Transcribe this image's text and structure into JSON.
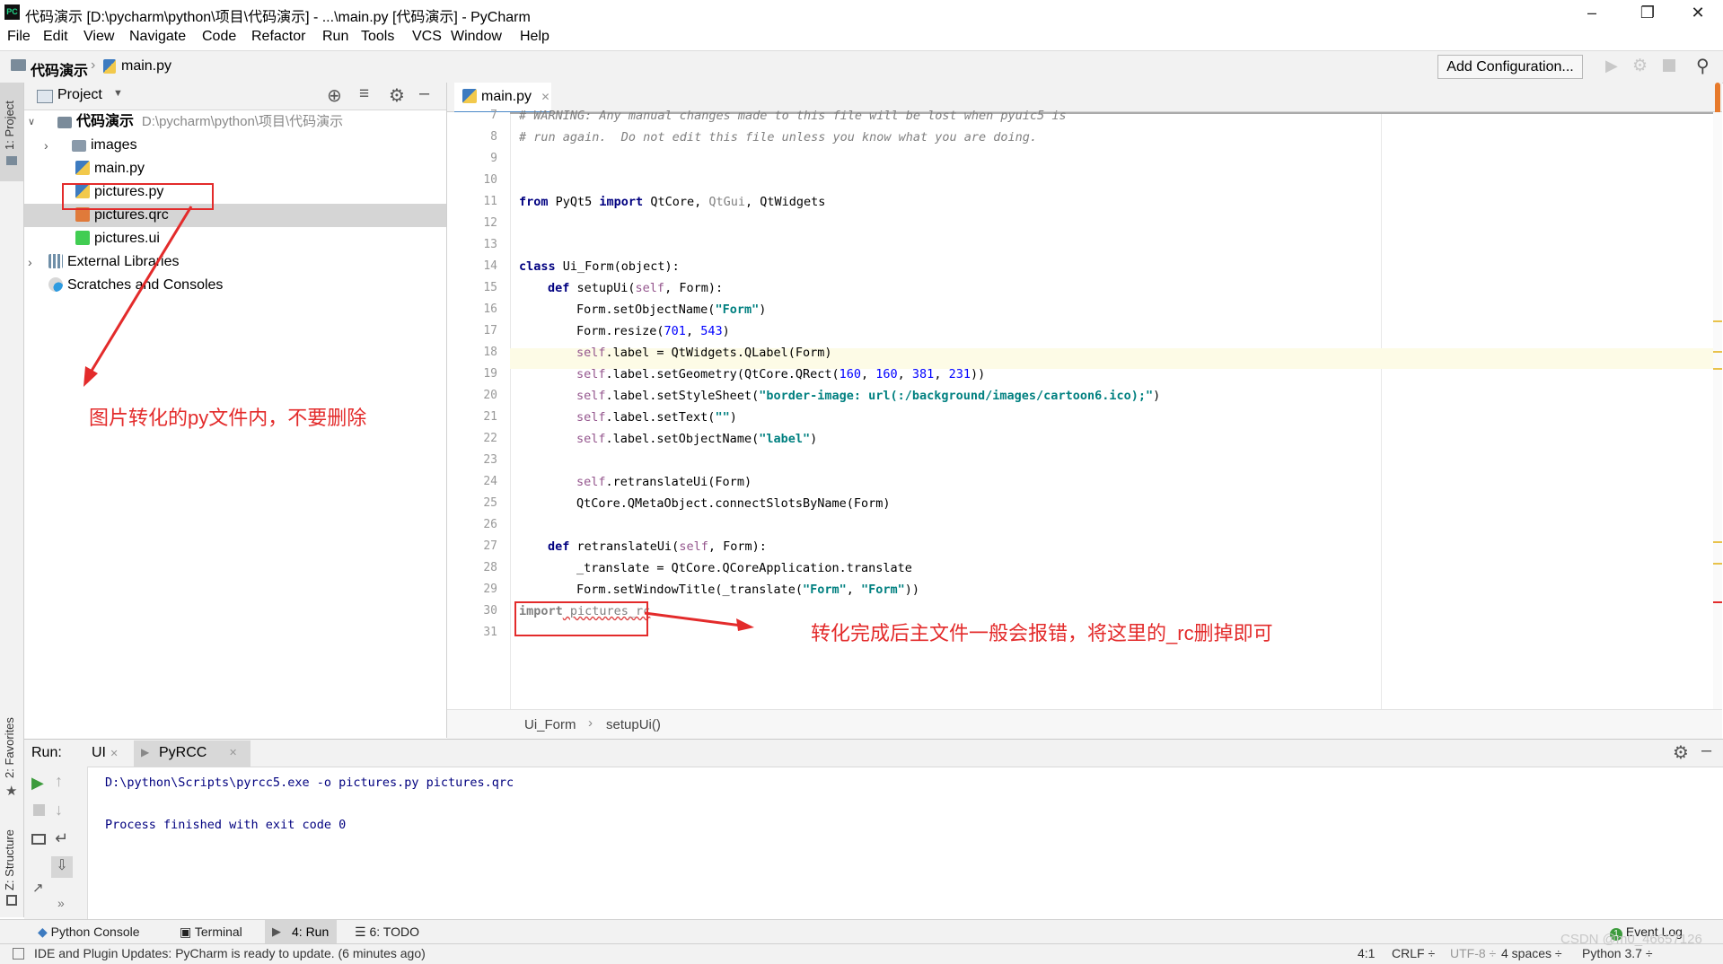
{
  "window": {
    "title": "代码演示 [D:\\pycharm\\python\\项目\\代码演示] - ...\\main.py [代码演示] - PyCharm",
    "app_icon": "PC"
  },
  "menu": [
    "File",
    "Edit",
    "View",
    "Navigate",
    "Code",
    "Refactor",
    "Run",
    "Tools",
    "VCS",
    "Window",
    "Help"
  ],
  "nav": {
    "project": "代码演示",
    "file": "main.py",
    "add_config": "Add Configuration..."
  },
  "left_strip": {
    "project": "1: Project",
    "favorites": "2: Favorites",
    "structure": "Z: Structure"
  },
  "project_panel": {
    "title": "Project",
    "root_name": "代码演示",
    "root_path": "D:\\pycharm\\python\\项目\\代码演示",
    "items": [
      "images",
      "main.py",
      "pictures.py",
      "pictures.qrc",
      "pictures.ui"
    ],
    "external": "External Libraries",
    "scratches": "Scratches and Consoles"
  },
  "editor": {
    "tab": "main.py",
    "line_numbers": [
      "7",
      "8",
      "9",
      "10",
      "11",
      "12",
      "13",
      "14",
      "15",
      "16",
      "17",
      "18",
      "19",
      "20",
      "21",
      "22",
      "23",
      "24",
      "25",
      "26",
      "27",
      "28",
      "29",
      "30",
      "31"
    ],
    "breadcrumb": [
      "Ui_Form",
      "setupUi()"
    ],
    "code": {
      "l7": "# WARNING: Any manual changes made to this file will be lost when pyuic5 is",
      "l8": "# run again.  Do not edit this file unless you know what you are doing.",
      "l11": [
        "from",
        " PyQt5 ",
        "import",
        " QtCore, ",
        "QtGui",
        ", QtWidgets"
      ],
      "l14": [
        "class",
        " Ui_Form(object):"
      ],
      "l15": [
        "def",
        " setupUi(",
        "self",
        ", Form):"
      ],
      "l16": [
        "Form.setObjectName(",
        "\"Form\"",
        ")"
      ],
      "l17": [
        "Form.resize(",
        "701",
        ", ",
        "543",
        ")"
      ],
      "l18": [
        "self",
        ".label = QtWidgets.QLabel(Form)"
      ],
      "l19": [
        "self",
        ".label.setGeometry(QtCore.QRect(",
        "160",
        ", ",
        "160",
        ", ",
        "381",
        ", ",
        "231",
        "))"
      ],
      "l20": [
        "self",
        ".label.setStyleSheet(",
        "\"border-image: url(:/background/images/cartoon6.ico);\"",
        ")"
      ],
      "l21": [
        "self",
        ".label.setText(",
        "\"\"",
        ")"
      ],
      "l22": [
        "self",
        ".label.setObjectName(",
        "\"label\"",
        ")"
      ],
      "l24": [
        "self",
        ".retranslateUi(Form)"
      ],
      "l25": "QtCore.QMetaObject.connectSlotsByName(Form)",
      "l27": [
        "def",
        " retranslateUi(",
        "self",
        ", Form):"
      ],
      "l28": "_translate = QtCore.QCoreApplication.translate",
      "l29": [
        "Form.setWindowTitle(_translate(",
        "\"Form\"",
        ", ",
        "\"Form\"",
        "))"
      ],
      "l30": [
        "import",
        " pictures_rc"
      ]
    }
  },
  "annotations": {
    "left": "图片转化的py文件内，不要删除",
    "right": "转化完成后主文件一般会报错，将这里的_rc删掉即可"
  },
  "run": {
    "label": "Run:",
    "tabs": [
      "UI",
      "PyRCC"
    ],
    "lines": [
      "D:\\python\\Scripts\\pyrcc5.exe -o pictures.py pictures.qrc",
      "Process finished with exit code 0"
    ]
  },
  "tool_tabs": [
    "Python Console",
    "Terminal",
    "4: Run",
    "6: TODO"
  ],
  "event_log": "Event Log",
  "status": {
    "message": "IDE and Plugin Updates: PyCharm is ready to update. (6 minutes ago)",
    "position": "4:1",
    "line_sep": "CRLF ÷",
    "encoding": "UTF-8 ÷",
    "indent": "4 spaces ÷",
    "interpreter": "Python 3.7 ÷",
    "watermark": "CSDN @m0_46657126"
  },
  "colors": {
    "accent": "#4a88c7",
    "annotation": "#e32b2b",
    "keyword": "#000080",
    "string": "#008080",
    "number": "#0000ff",
    "self": "#94558d"
  }
}
